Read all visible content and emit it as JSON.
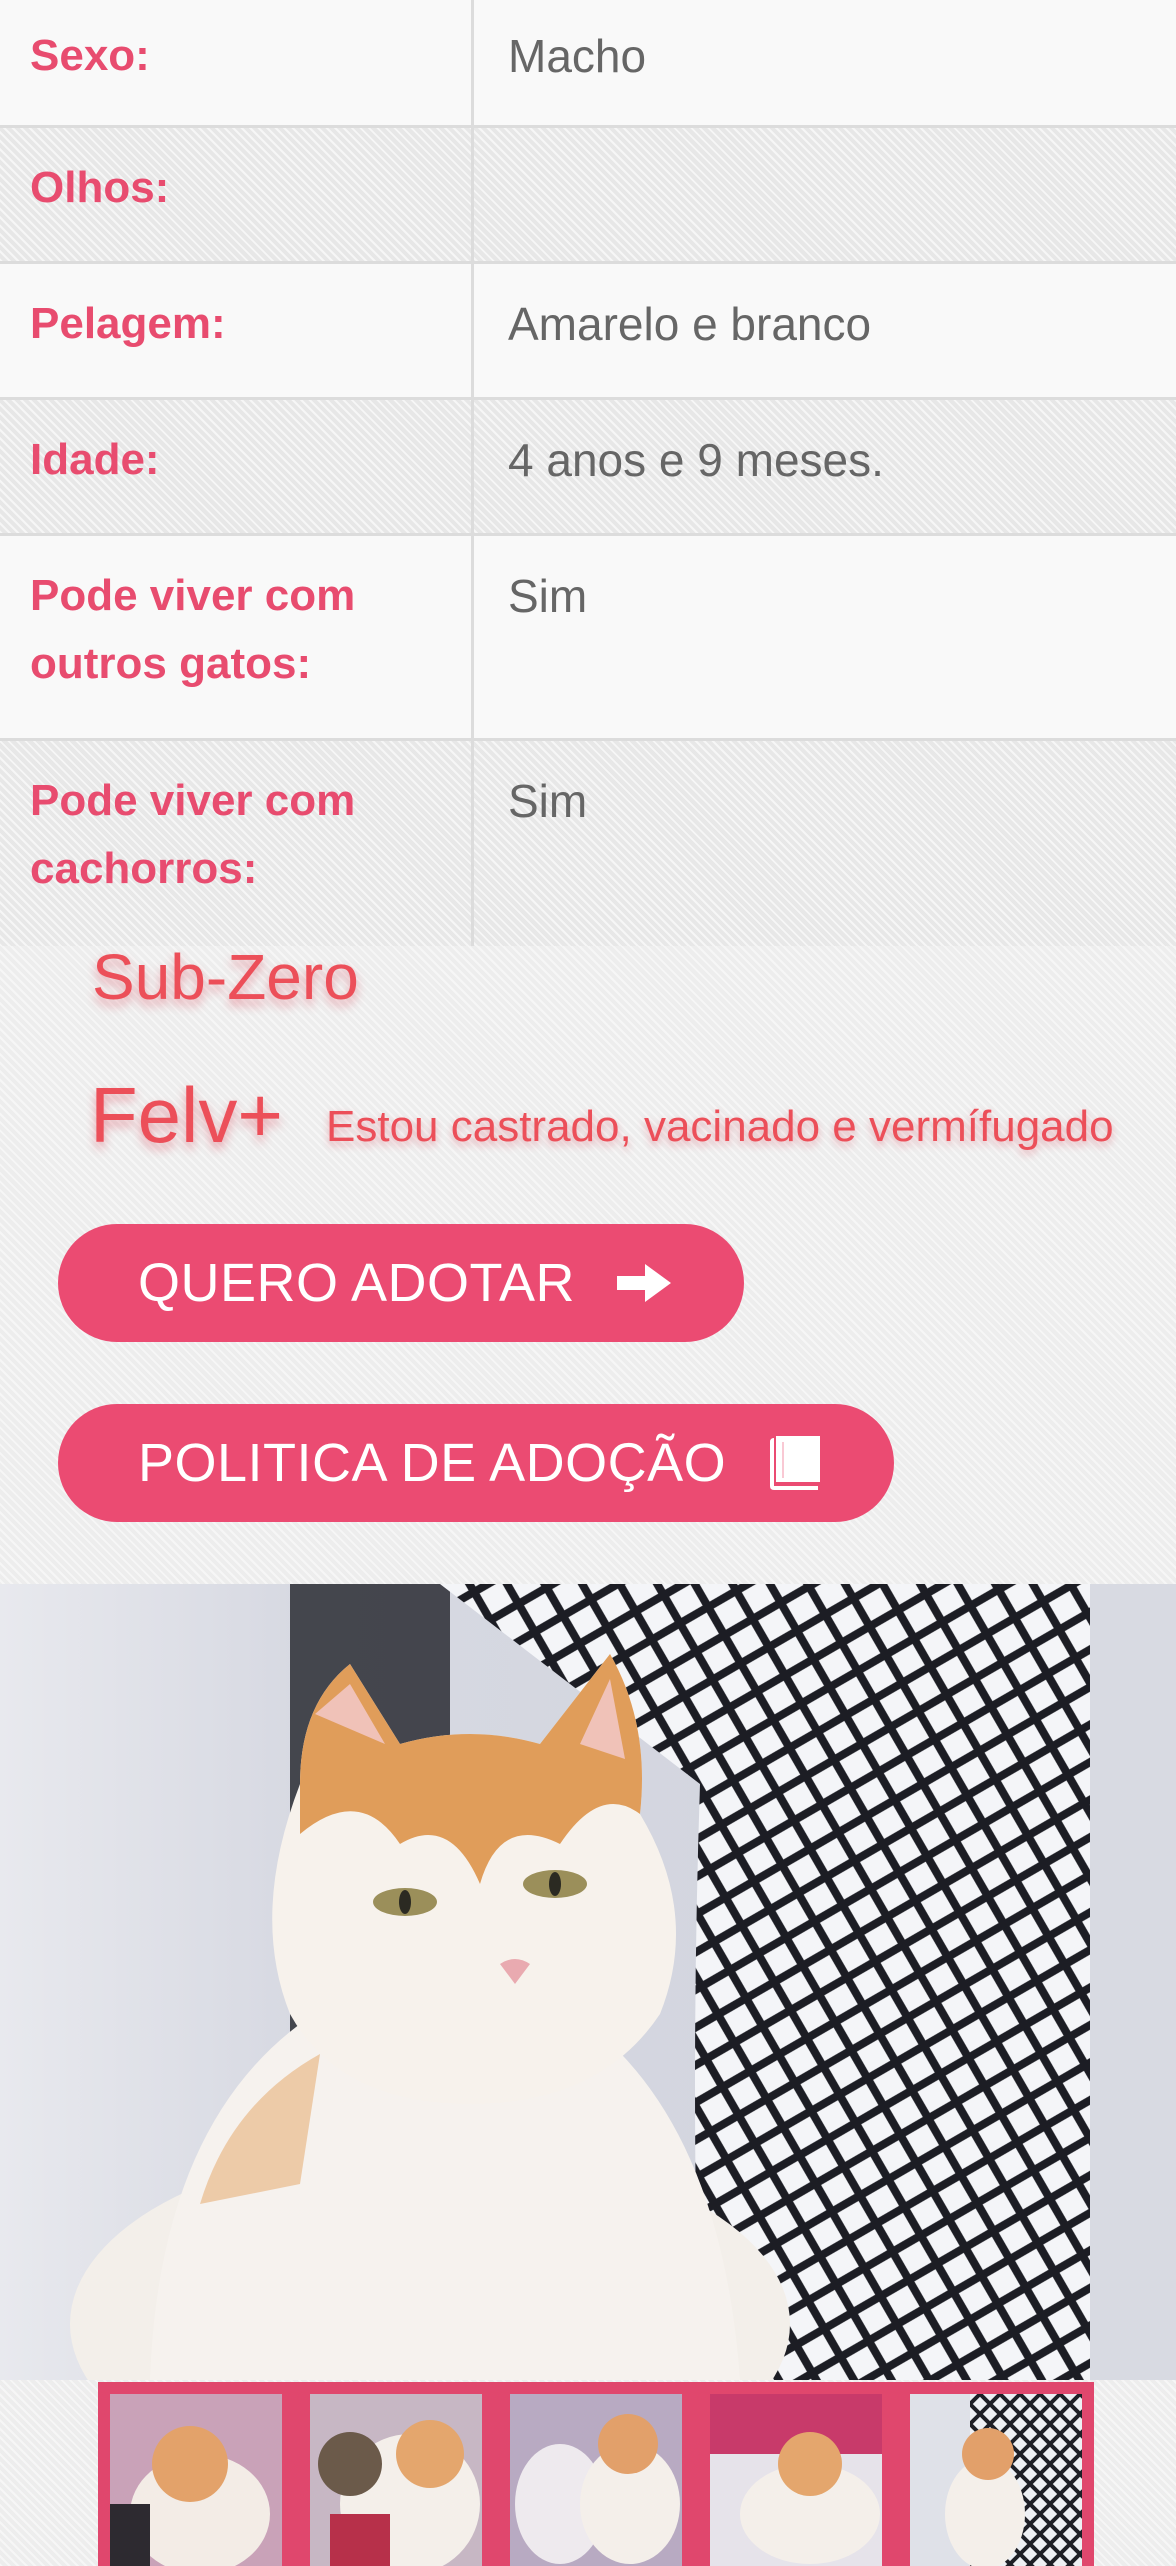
{
  "details": [
    {
      "label": "Sexo:",
      "value": "Macho"
    },
    {
      "label": "Olhos:",
      "value": ""
    },
    {
      "label": "Pelagem:",
      "value": "Amarelo e branco"
    },
    {
      "label": "Idade:",
      "value": "4 anos e 9 meses."
    },
    {
      "label": "Pode viver com outros gatos:",
      "value": "Sim"
    },
    {
      "label": "Pode viver com cachorros:",
      "value": "Sim"
    }
  ],
  "cat": {
    "name": "Sub-Zero",
    "status": "Felv+",
    "note": "Estou castrado, vacinado e vermífugado"
  },
  "buttons": {
    "adopt": "QUERO ADOTAR",
    "policy": "POLITICA DE ADOÇÃO"
  },
  "icons": {
    "adopt": "arrow-right-icon",
    "policy": "book-icon"
  },
  "colors": {
    "accent": "#eb4b72",
    "label_text": "#e84c6f",
    "value_text": "#666666"
  }
}
